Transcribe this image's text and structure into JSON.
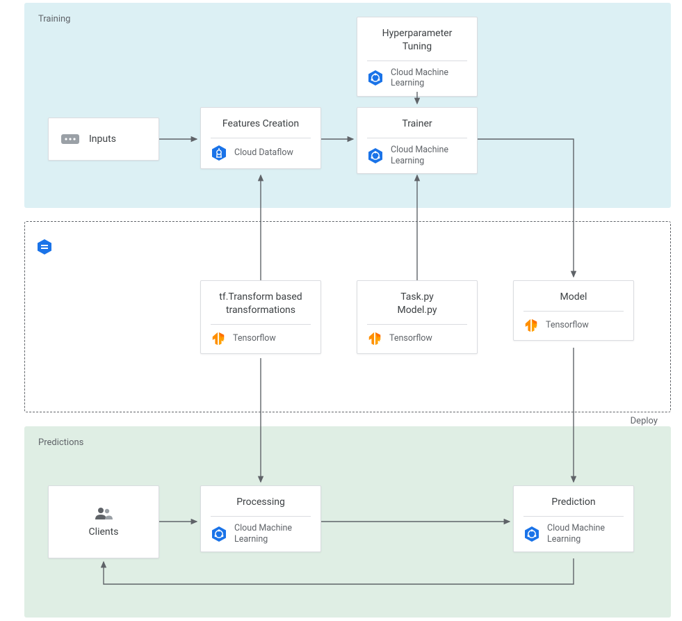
{
  "panels": {
    "training": "Training",
    "predictions": "Predictions"
  },
  "deploy_label": "Deploy",
  "icons": {
    "cml": "Cloud Machine\nLearning",
    "dataflow": "Cloud Dataflow",
    "tensorflow": "Tensorflow"
  },
  "nodes": {
    "inputs": {
      "title": "Inputs"
    },
    "features": {
      "title": "Features Creation",
      "sub": "Cloud Dataflow"
    },
    "hyper": {
      "title": "Hyperparameter\nTuning",
      "sub": "Cloud Machine\nLearning"
    },
    "trainer": {
      "title": "Trainer",
      "sub": "Cloud Machine\nLearning"
    },
    "tftransform": {
      "title": "tf.Transform based\ntransformations",
      "sub": "Tensorflow"
    },
    "taskmodel": {
      "title": "Task.py\nModel.py",
      "sub": "Tensorflow"
    },
    "model": {
      "title": "Model",
      "sub": "Tensorflow"
    },
    "clients": {
      "title": "Clients"
    },
    "processing": {
      "title": "Processing",
      "sub": "Cloud Machine\nLearning"
    },
    "prediction": {
      "title": "Prediction",
      "sub": "Cloud Machine\nLearning"
    }
  }
}
